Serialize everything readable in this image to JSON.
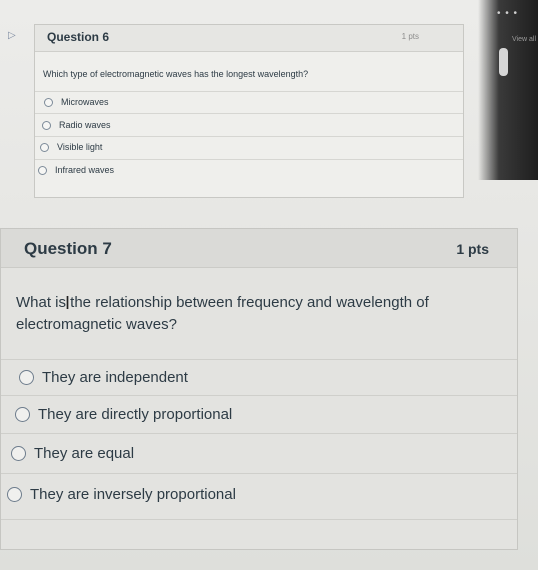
{
  "question6": {
    "title": "Question 6",
    "points": "1 pts",
    "text": "Which type of electromagnetic waves has the longest wavelength?",
    "options": [
      "Microwaves",
      "Radio waves",
      "Visible light",
      "Infrared waves"
    ]
  },
  "question7": {
    "title": "Question 7",
    "points": "1 pts",
    "text": "What is the relationship between frequency and wavelength of electromagnetic waves?",
    "options": [
      "They are independent",
      "They are directly proportional",
      "They are equal",
      "They are inversely proportional"
    ]
  },
  "side_panel": {
    "menu": "• • •",
    "view_label": "View all"
  }
}
